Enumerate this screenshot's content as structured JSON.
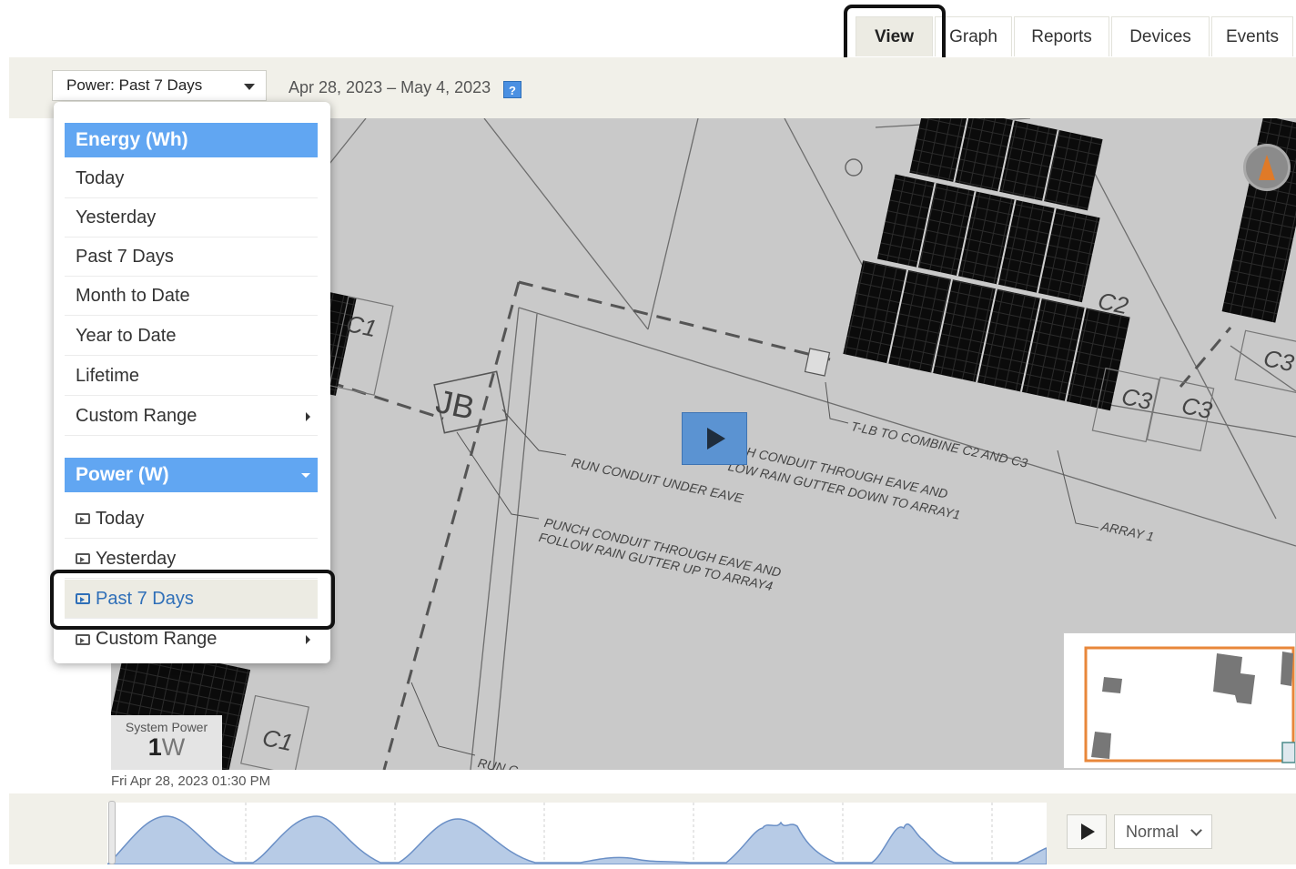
{
  "tabs": [
    {
      "label": "View",
      "active": true
    },
    {
      "label": "Graph",
      "active": false
    },
    {
      "label": "Reports",
      "active": false
    },
    {
      "label": "Devices",
      "active": false
    },
    {
      "label": "Events",
      "active": false
    }
  ],
  "toolbar": {
    "period_select": "Power: Past 7 Days",
    "date_range": "Apr 28, 2023 – May 4, 2023",
    "help": "?"
  },
  "dropdown": {
    "energy_header": "Energy (Wh)",
    "energy_items": [
      "Today",
      "Yesterday",
      "Past 7 Days",
      "Month to Date",
      "Year to Date",
      "Lifetime",
      "Custom Range"
    ],
    "power_header": "Power (W)",
    "power_items": [
      "Today",
      "Yesterday",
      "Past 7 Days",
      "Custom Range"
    ],
    "selected": "Past 7 Days"
  },
  "map": {
    "labels": {
      "jb": "JB",
      "c1a": "C1",
      "c1b": "C1",
      "c2": "C2",
      "c3a": "C3",
      "c3b": "C3",
      "c3c": "C3",
      "tlb": "T-LB TO COMBINE C2 AND C3",
      "run_conduit": "RUN CONDUIT UNDER EAVE",
      "punch1": "H CONDUIT THROUGH EAVE AND",
      "punch1b": "LOW RAIN GUTTER DOWN TO ARRAY1",
      "punch2": "PUNCH CONDUIT THROUGH EAVE AND",
      "punch2b": "FOLLOW RAIN GUTTER UP TO ARRAY4",
      "array1": "ARRAY 1",
      "run_cut": "RUN C"
    }
  },
  "system_power": {
    "label": "System Power",
    "value": "1",
    "unit": "W"
  },
  "timestamp": "Fri Apr 28, 2023 01:30 PM",
  "timeline": {
    "speed": "Normal"
  },
  "colors": {
    "accent": "#61a6f2",
    "panel": "#0a0a0a",
    "toolbar": "#f1f0e9",
    "map": "#c9c9c9",
    "minimap_border": "#e8873a"
  }
}
